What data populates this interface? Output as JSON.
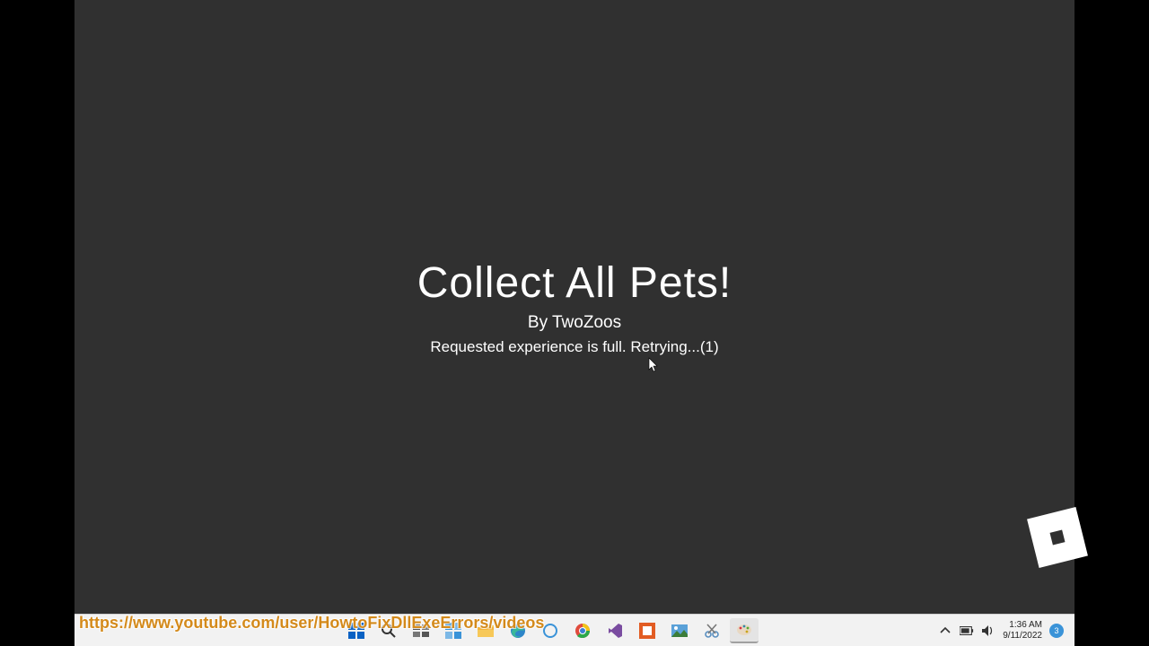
{
  "game": {
    "title": "Collect All Pets!",
    "author_line": "By TwoZoos",
    "status_line": "Requested experience is full. Retrying...(1)"
  },
  "overlay": {
    "url": "https://www.youtube.com/user/HowtoFixDllExeErrors/videos"
  },
  "taskbar": {
    "icons": {
      "start": "start-icon",
      "search": "search-icon",
      "taskview": "taskview-icon",
      "widgets": "widgets-icon",
      "explorer": "file-explorer-icon",
      "edge": "edge-icon",
      "cortana": "cortana-icon",
      "chrome": "chrome-icon",
      "vs": "visual-studio-icon",
      "adobe": "adobe-icon",
      "photos": "photos-icon",
      "snip": "snip-icon",
      "paint": "paint-icon"
    },
    "tray": {
      "chevron": "chevron-up-icon",
      "battery": "battery-icon",
      "volume": "volume-icon"
    },
    "clock": {
      "time": "1:36 AM",
      "date": "9/11/2022"
    },
    "notifications": "3"
  }
}
